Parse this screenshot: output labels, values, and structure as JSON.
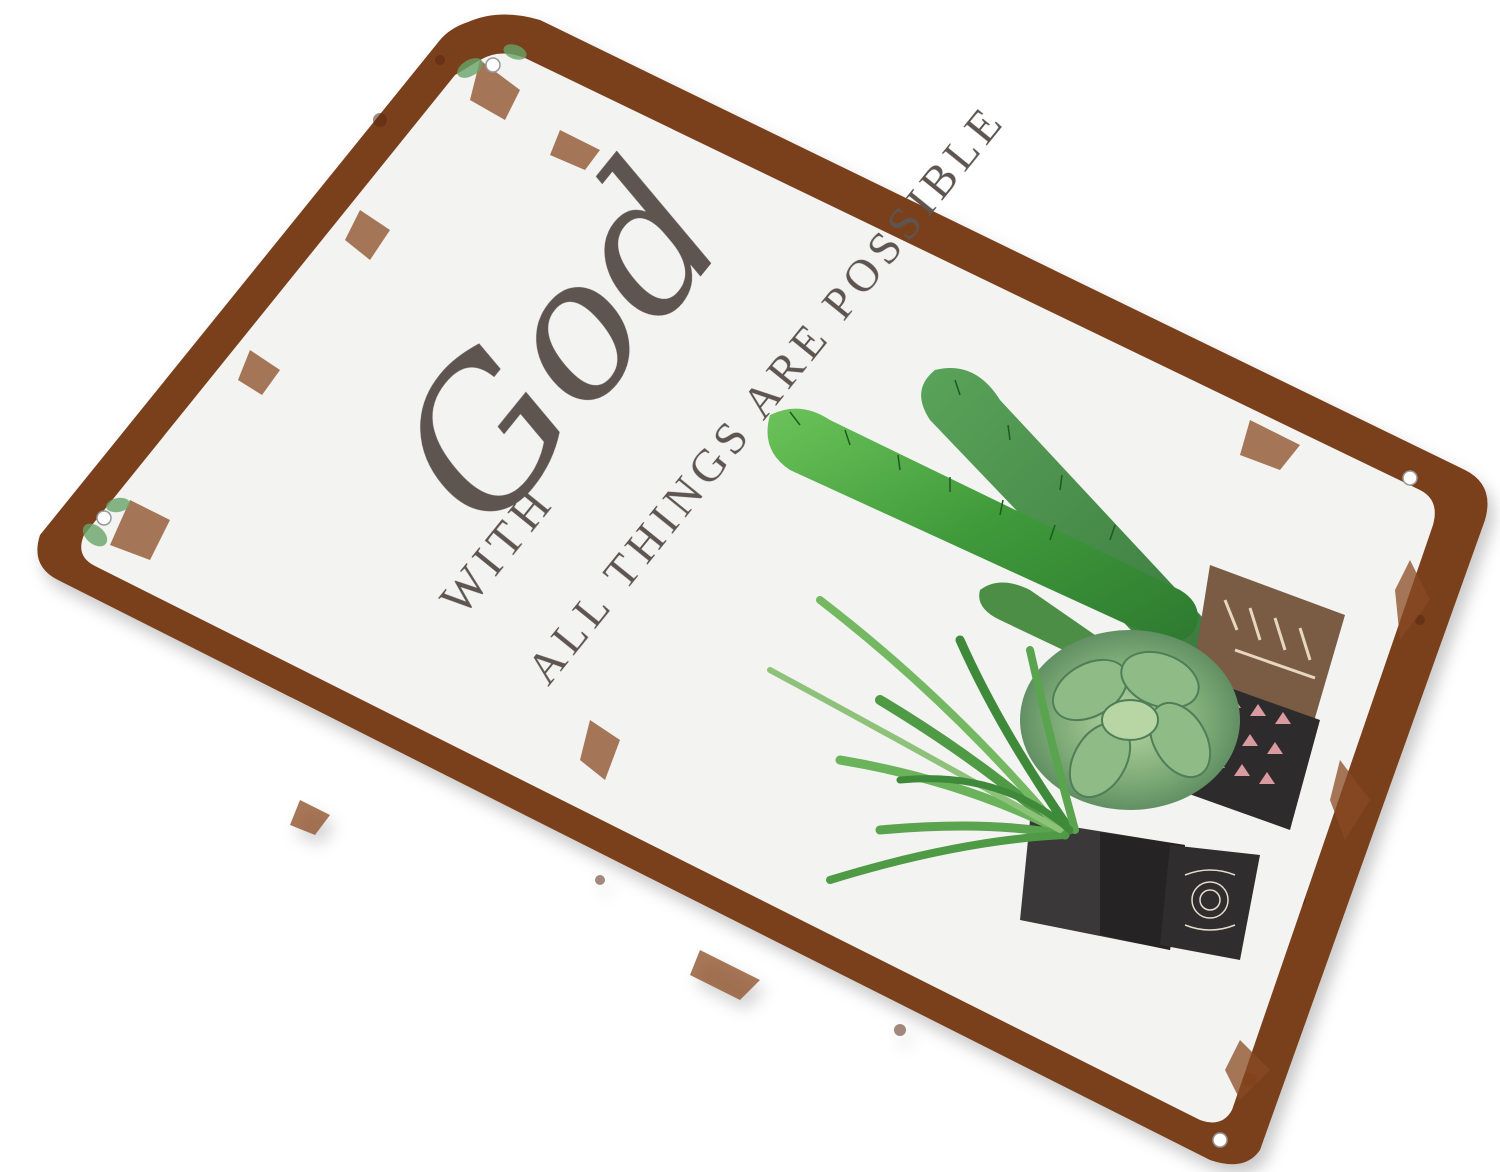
{
  "sign": {
    "line_with": "WITH",
    "line_god": "God",
    "line_rest": "ALL THINGS ARE POSSIBLE"
  },
  "colors": {
    "background": "#ffffff",
    "rust": "#7a3f1c",
    "rust_dark": "#5a2a12",
    "panel": "#f3f3f1",
    "text": "#5e5550",
    "cactus_green": "#3f9a3a",
    "succulent_green": "#7aa874",
    "pot_brown": "#7a5c44",
    "pot_black": "#2d2b2b"
  },
  "icons": {
    "mount_holes": "screw-hole-icon",
    "plants": "potted-cactus-illustration"
  }
}
